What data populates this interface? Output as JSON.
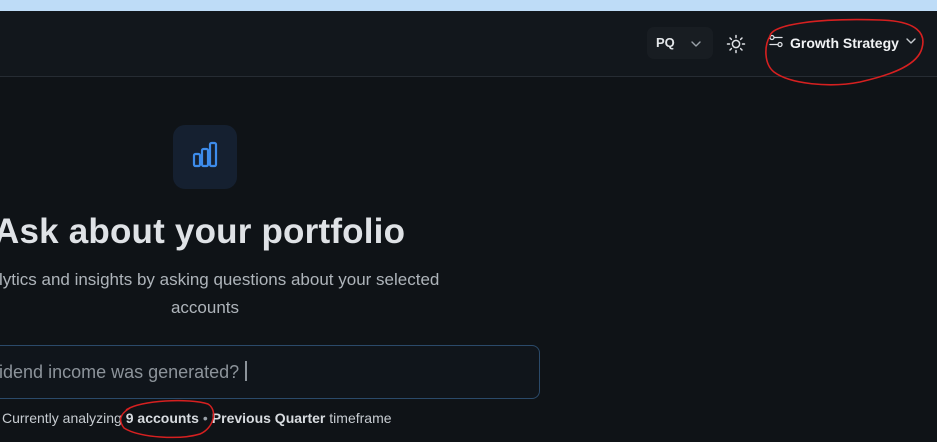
{
  "header": {
    "period": {
      "label": "PQ"
    },
    "strategy": {
      "label": "Growth Strategy"
    }
  },
  "hero": {
    "title": "Ask about your portfolio",
    "subtitle_line1": "analytics and insights by asking questions about your selected",
    "subtitle_line2": "accounts"
  },
  "input": {
    "value": "n dividend income was generated?"
  },
  "status": {
    "prefix": "Currently analyzing",
    "accounts": "9 accounts",
    "period": "Previous Quarter",
    "suffix": "timeframe"
  },
  "colors": {
    "background": "#0f1317",
    "header": "#12171c",
    "accent": "#3d8bea",
    "annotation": "#d62020"
  },
  "icons": [
    "chevron-down-icon",
    "sun-icon",
    "sliders-icon",
    "bar-chart-icon"
  ]
}
